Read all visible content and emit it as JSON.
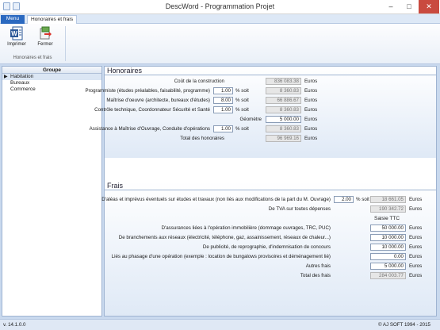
{
  "window": {
    "title": "DescWord - Programmation Projet"
  },
  "ribbon": {
    "tabs": [
      "Menu",
      "Honoraires et frais"
    ],
    "buttons": {
      "print": "Imprimer",
      "close": "Fermer"
    },
    "group_label": "Honoraires et frais"
  },
  "left": {
    "header": "Groupe",
    "items": [
      "Habitation",
      "Bureaux",
      "Commerce"
    ]
  },
  "honoraires": {
    "title": "Honoraires",
    "cout": {
      "label": "Coût de la construction",
      "value": "836 083.38",
      "unit": "Euros"
    },
    "programmiste": {
      "label": "Programmiste (études préalables, faisabilité, programme)",
      "pct": "1.00",
      "soit": "% soit",
      "value": "8 360.83",
      "unit": "Euros"
    },
    "maitrise": {
      "label": "Maîtrise d'oeuvre (architecte, bureaux d'études)",
      "pct": "8.00",
      "soit": "% soit",
      "value": "66 886.67",
      "unit": "Euros"
    },
    "controle": {
      "label": "Contrôle technique, Coordonnateur Sécurité et Santé",
      "pct": "1.00",
      "soit": "% soit",
      "value": "8 360.83",
      "unit": "Euros"
    },
    "geometre": {
      "label": "Géomètre",
      "value": "5 000.00",
      "unit": "Euros"
    },
    "assistance": {
      "label": "Assistance à Maîtrise d'Ouvrage, Conduite d'opérations",
      "pct": "1.00",
      "soit": "% soit",
      "value": "8 360.83",
      "unit": "Euros"
    },
    "total": {
      "label": "Total des honoraires",
      "value": "96 969.16",
      "unit": "Euros"
    }
  },
  "frais": {
    "title": "Frais",
    "aleas": {
      "label": "D'aléas et imprévus éventuels sur études et travaux (non liés aux modifications de la part du M. Ouvrage)",
      "pct": "2.00",
      "soit": "% soit",
      "value": "18 661.05",
      "unit": "Euros"
    },
    "tva": {
      "label": "De TVA sur toutes dépenses",
      "value": "190 342.72",
      "unit": "Euros"
    },
    "saisie_header": "Saisie TTC",
    "assurances": {
      "label": "D'assurances liées à l'opération immobilière (dommage ouvrages, TRC, PUC)",
      "value": "50 000.00",
      "unit": "Euros"
    },
    "branchements": {
      "label": "De branchements aux réseaux (électricité, téléphone, gaz, assainissement, réseaux de chaleur...)",
      "value": "10 000.00",
      "unit": "Euros"
    },
    "publicite": {
      "label": "De publicité, de reprographie, d'indemnisation de concours",
      "value": "10 000.00",
      "unit": "Euros"
    },
    "phasage": {
      "label": "Liés au phasage d'une opération (exemple : location de bungalows provisoires et déménagement lié)",
      "value": "0.00",
      "unit": "Euros"
    },
    "autres": {
      "label": "Autres frais",
      "value": "5 000.00",
      "unit": "Euros"
    },
    "total": {
      "label": "Total des frais",
      "value": "284 003.77",
      "unit": "Euros"
    }
  },
  "status": {
    "version": "v. 14.1.0.0",
    "copyright": "© AJ SOFT 1994 - 2015"
  }
}
